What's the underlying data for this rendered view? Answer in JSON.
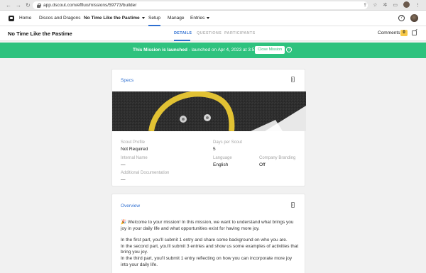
{
  "browser": {
    "url": "app.dscout.com/efflux/missions/59773/builder"
  },
  "nav": {
    "home": "Home",
    "project": "Discos and Dragons",
    "mission": "No Time Like the Pastime",
    "setup": "Setup",
    "manage": "Manage",
    "entries": "Entries",
    "help": "?"
  },
  "header": {
    "title": "No Time Like the Pastime",
    "tabs": [
      "DETAILS",
      "QUESTIONS",
      "PARTICIPANTS"
    ],
    "comments_label": "Comments",
    "comments_count": "0"
  },
  "banner": {
    "bold": "This Mission is launched",
    "rest": " - launched on Apr 4, 2023 at 3:51 pm",
    "button": "Close Mission",
    "help": "?"
  },
  "specs": {
    "title": "Specs",
    "fields": [
      {
        "label": "Scout Profile",
        "value": "Not Required"
      },
      {
        "label": "Days per Scout",
        "value": "5"
      },
      {
        "label": "Internal Name",
        "value": "—"
      },
      {
        "label": "Language",
        "value": "English"
      },
      {
        "label": "Company Branding",
        "value": "Off"
      },
      {
        "label": "Additional Documentation",
        "value": "—"
      }
    ]
  },
  "overview": {
    "title": "Overview",
    "paragraphs": [
      "🎉 Welcome to your mission! In this mission, we want to understand what brings you joy in your daily life and what opportunities exist for having more joy.",
      "In the first part, you'll submit 1 entry and share some background on who you are.",
      "In the second part, you'll submit 3 entries and show us some examples of activities that bring you joy.",
      "In the third part, you'll submit 1 entry reflecting on how you can incorporate more joy into your daily life."
    ]
  }
}
